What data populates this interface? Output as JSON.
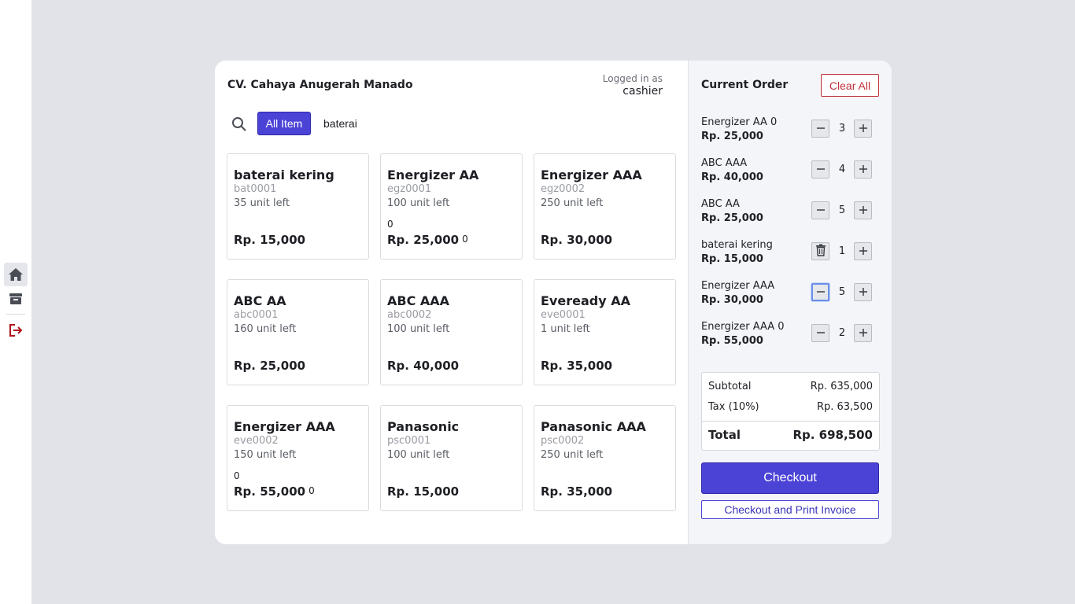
{
  "sidebar": {
    "items": [
      {
        "name": "home",
        "icon": "home-icon",
        "active": true
      },
      {
        "name": "inventory",
        "icon": "archive-box-icon",
        "active": false
      },
      {
        "name": "logout",
        "icon": "logout-icon",
        "active": false
      }
    ]
  },
  "header": {
    "store_name": "CV. Cahaya Anugerah Manado",
    "login_caption": "Logged in as",
    "login_user": "cashier"
  },
  "search": {
    "filter_label": "All Item",
    "value": "baterai"
  },
  "products": [
    {
      "name": "baterai kering",
      "code": "bat0001",
      "stock": "35 unit left",
      "price": "Rp. 15,000",
      "zero_note": "",
      "price_suffix": ""
    },
    {
      "name": "Energizer AA",
      "code": "egz0001",
      "stock": "100 unit left",
      "price": "Rp. 25,000",
      "zero_note": "0",
      "price_suffix": "0"
    },
    {
      "name": "Energizer AAA",
      "code": "egz0002",
      "stock": "250 unit left",
      "price": "Rp. 30,000",
      "zero_note": "",
      "price_suffix": ""
    },
    {
      "name": "ABC AA",
      "code": "abc0001",
      "stock": "160 unit left",
      "price": "Rp. 25,000",
      "zero_note": "",
      "price_suffix": ""
    },
    {
      "name": "ABC AAA",
      "code": "abc0002",
      "stock": "100 unit left",
      "price": "Rp. 40,000",
      "zero_note": "",
      "price_suffix": ""
    },
    {
      "name": "Eveready AA",
      "code": "eve0001",
      "stock": "1 unit left",
      "price": "Rp. 35,000",
      "zero_note": "",
      "price_suffix": ""
    },
    {
      "name": "Energizer AAA",
      "code": "eve0002",
      "stock": "150 unit left",
      "price": "Rp. 55,000",
      "zero_note": "0",
      "price_suffix": "0"
    },
    {
      "name": "Panasonic",
      "code": "psc0001",
      "stock": "100 unit left",
      "price": "Rp. 15,000",
      "zero_note": "",
      "price_suffix": ""
    },
    {
      "name": "Panasonic AAA",
      "code": "psc0002",
      "stock": "250 unit left",
      "price": "Rp. 35,000",
      "zero_note": "",
      "price_suffix": ""
    }
  ],
  "order": {
    "title": "Current Order",
    "clear_label": "Clear All",
    "lines": [
      {
        "name": "Energizer AA 0",
        "price": "Rp. 25,000",
        "qty": "3",
        "minus_icon": "minus-icon"
      },
      {
        "name": "ABC AAA",
        "price": "Rp. 40,000",
        "qty": "4",
        "minus_icon": "minus-icon"
      },
      {
        "name": "ABC AA",
        "price": "Rp. 25,000",
        "qty": "5",
        "minus_icon": "minus-icon"
      },
      {
        "name": "baterai kering",
        "price": "Rp. 15,000",
        "qty": "1",
        "minus_icon": "trash-icon"
      },
      {
        "name": "Energizer AAA",
        "price": "Rp. 30,000",
        "qty": "5",
        "minus_icon": "minus-icon",
        "focused": true
      },
      {
        "name": "Energizer AAA 0",
        "price": "Rp. 55,000",
        "qty": "2",
        "minus_icon": "minus-icon"
      }
    ],
    "summary": {
      "subtotal_label": "Subtotal",
      "subtotal_value": "Rp. 635,000",
      "tax_label": "Tax (10%)",
      "tax_value": "Rp. 63,500",
      "total_label": "Total",
      "total_value": "Rp. 698,500"
    },
    "checkout_label": "Checkout",
    "print_label": "Checkout and Print Invoice"
  },
  "colors": {
    "accent": "#4b43d6",
    "danger": "#c0303a",
    "background": "#e2e3e8"
  }
}
